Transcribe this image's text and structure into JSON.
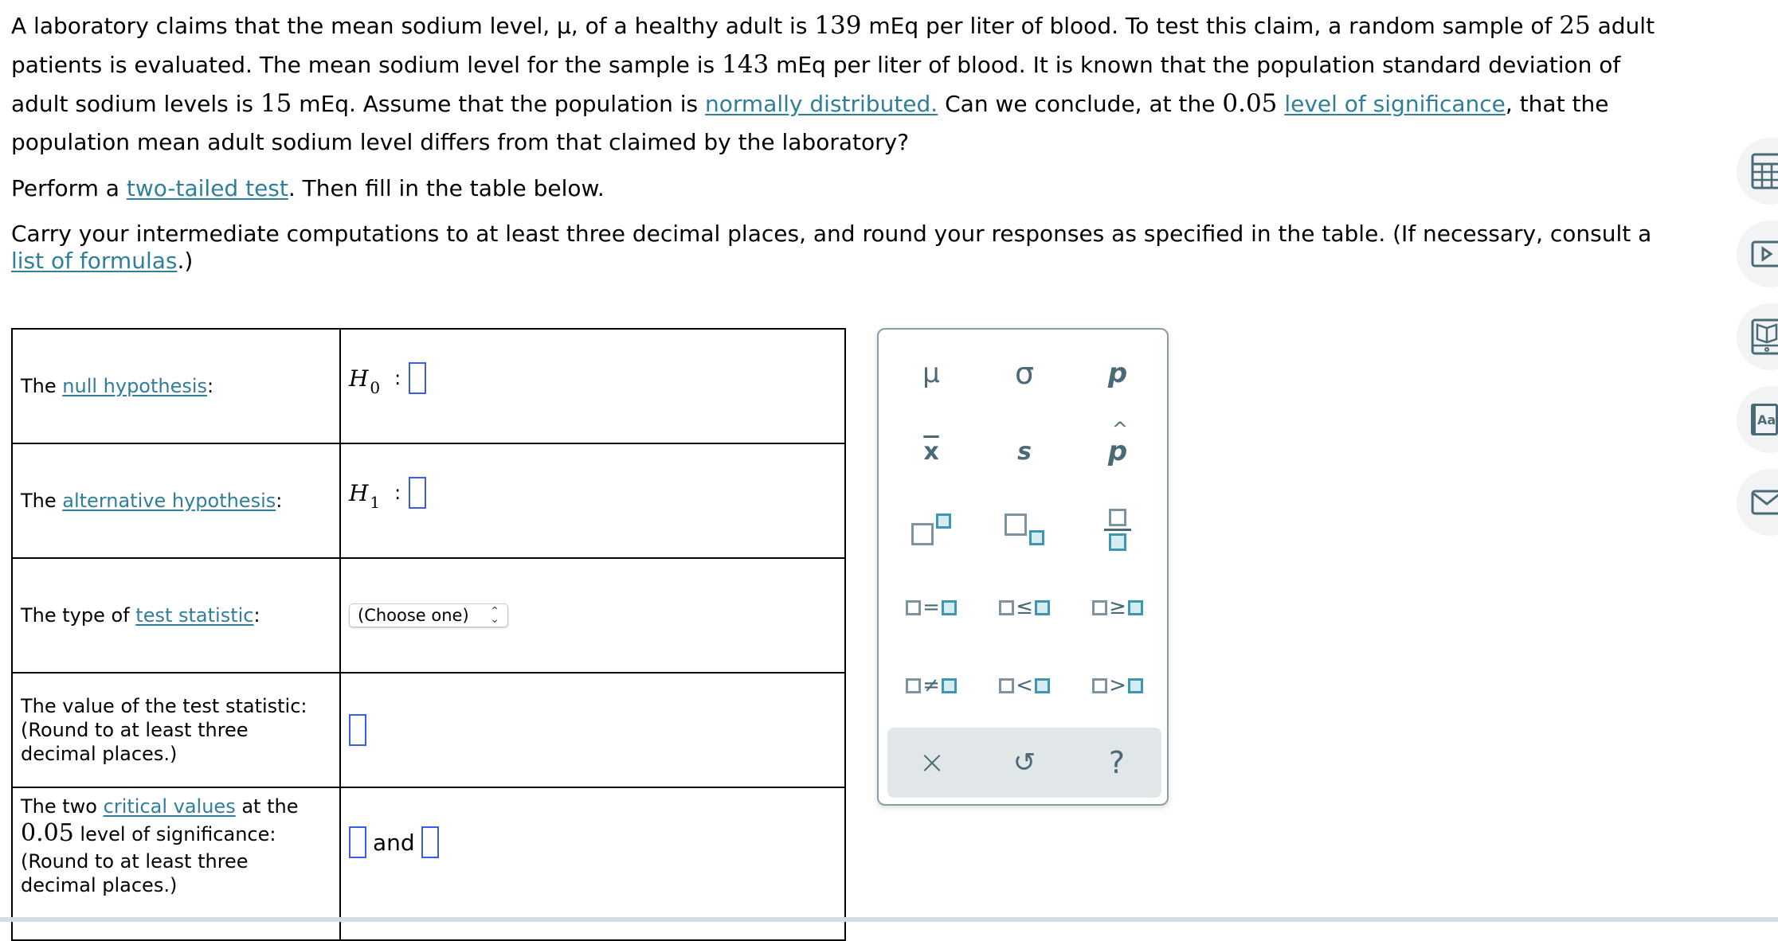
{
  "problem": {
    "p1": {
      "t1": "A laboratory claims that the mean sodium level, μ, of a healthy adult is ",
      "mu_value": "139",
      "t2": " mEq per liter of blood. To test this claim, a random sample of ",
      "n": "25",
      "t3": " adult patients is evaluated. The mean sodium level for the sample is ",
      "xbar": "143",
      "t4": " mEq per liter of blood. It is known that the population standard deviation of adult sodium levels is ",
      "sigma": "15",
      "t5": " mEq. Assume that the population is ",
      "link_normal": "normally distributed.",
      "t6": " Can we conclude, at the ",
      "alpha": "0.05",
      "t7": " ",
      "link_los": "level of significance",
      "t8": ", that the population mean adult sodium level differs from that claimed by the laboratory?"
    },
    "p2": {
      "t1": "Perform a ",
      "link": "two-tailed test",
      "t2": ". Then fill in the table below."
    },
    "p3": {
      "t1": "Carry your intermediate computations to at least three decimal places, and round your responses as specified in the table. (If necessary, consult a ",
      "link": "list of formulas",
      "t2": ".)"
    }
  },
  "table": {
    "null": {
      "pre": "The ",
      "link": "null hypothesis",
      "post": ":",
      "H": "H",
      "sub": "0",
      "colon": ":"
    },
    "alt": {
      "pre": "The ",
      "link": "alternative hypothesis",
      "post": ":",
      "H": "H",
      "sub": "1",
      "colon": ":"
    },
    "type": {
      "pre": "The type of ",
      "link": "test statistic",
      "post": ":",
      "select_value": "(Choose one)"
    },
    "value": {
      "line1": "The value of the test statistic:",
      "line2": "(Round to at least three",
      "line3": "decimal places.)"
    },
    "critical": {
      "pre": "The two ",
      "link": "critical values",
      "post": " at the",
      "alpha": "0.05",
      "line2": " level of significance:",
      "line3": "(Round to at least three",
      "line4": "decimal places.)",
      "and": "and"
    }
  },
  "palette": {
    "symbols": [
      "μ",
      "σ",
      "p",
      "x",
      "s",
      "p"
    ],
    "ops": [
      "=",
      "≤",
      "≥",
      "≠",
      "<",
      ">"
    ],
    "actions": {
      "clear": "×",
      "undo": "↺",
      "help": "?"
    }
  },
  "sidebar": {
    "icons": [
      "calculator-icon",
      "video-icon",
      "ebook-icon",
      "glossary-icon",
      "message-icon"
    ],
    "glossary_label": "Aa"
  },
  "colors": {
    "link": "#2f7f9a",
    "input_border": "#3a5de6",
    "palette_icon": "#4b6a78"
  }
}
